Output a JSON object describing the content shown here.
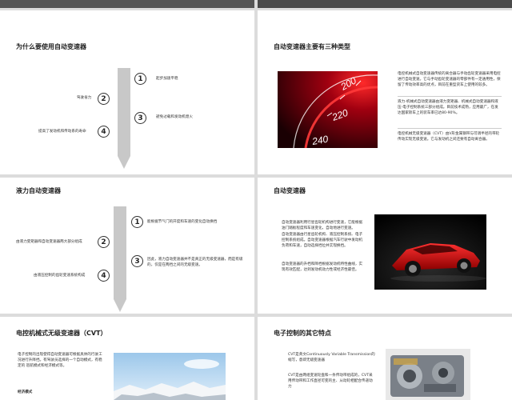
{
  "slides": {
    "s1": {
      "title": "为什么要使用自动变速器",
      "item1_num": "1",
      "item1_text": "起步加速平稳",
      "item2_num": "2",
      "item2_text": "驾驶省力",
      "item3_num": "3",
      "item3_text": "避免过载和发动机熄火",
      "item4_num": "4",
      "item4_text": "提高了发动机和传动系的寿命"
    },
    "s2": {
      "title": "自动变速器主要有三种类型",
      "gauge_labels": [
        "200",
        "220",
        "240"
      ],
      "para1": "电控机械式自动变速器传统的离合器与手动齿轮变速器采用电控进行自动变速。它与手动齿轮变速器的零部件有一定通用性，保留了传动效率高的优点，目前在重型货车上使用的较多。",
      "para2": "液力-机械式自动变速器由液力变矩器、机械式自动变速器和液压-电子控制系统三部分组成。目前技术成熟，应用最广，在发达国家轿车上的装车率已达80-90%。",
      "para3": "电控机械无级变速器（CVT）由V形金属钢带与可调半径的带轮传动实现无级变速。它与发动机之间还要有自动离合器。"
    },
    "s3": {
      "title": "液力自动变速器",
      "item1_num": "1",
      "item1_text": "能根据节气门的开度和车速的变化自动换挡",
      "item2_num": "2",
      "item2_text": "由液力变矩器和自动变速器两大部分组成",
      "item3_num": "3",
      "item3_text": "因此，液力自动变速器并不是真正的无级变速器，而是有级的，仅是在两挡之间的无级变速。",
      "item4_num": "4",
      "item4_text": "由液压控制的齿轮变速系统构成"
    },
    "s4": {
      "title": "自动变速器",
      "para1": "自动变速器利用行星齿轮机构进行变速，它能根据油门踏板程度和车速变化，自动地进行变速。",
      "para2": "自动变速器由行星齿轮机构、液压控制系统、电子控制系统组成。自动变速器根据汽车行驶中发动机负荷和车速，自动选择挡位并实现换挡。",
      "para3": "自动变速器的升档和降档根据发动机特性曲线，实现有效匹配，达到发动机动力性或经济性最佳。"
    },
    "s5": {
      "title": "电控机械式无级变速器（CVT）",
      "para1": "电子控制的出现使得自动变速器可根据具体的行驶工况进行升降挡。有驾驶员选择的一个自动模式，有稳定的 巡航模式和经济模式等。",
      "sub": "经济模式"
    },
    "s6": {
      "title": "电子控制的其它特点",
      "para1": "CVT是英文Continuously Variable Transmission的缩写，意即无级变速器",
      "para2": "CVT是由两组变速轮盘和一条传动带组成的，CVT采用传动带和工作直径可变的主、从动轮相配合传递动力"
    }
  },
  "colors": {
    "arrow": "#c8c8c8",
    "accent_red": "#c8102e",
    "text": "#222222"
  }
}
